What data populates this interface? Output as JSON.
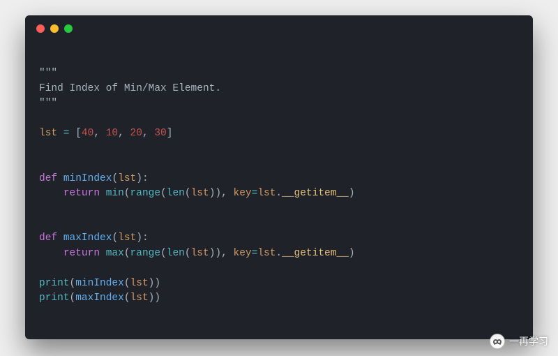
{
  "code": {
    "docstring_open": "\"\"\"",
    "docstring_text": "Find Index of Min/Max Element.",
    "docstring_close": "\"\"\"",
    "lst_name": "lst",
    "assign_op": " = ",
    "list_open": "[",
    "list_close": "]",
    "values": [
      "40",
      "10",
      "20",
      "30"
    ],
    "comma": ", ",
    "def_kw": "def",
    "fn_min": "minIndex",
    "fn_max": "maxIndex",
    "param": "lst",
    "paren_open": "(",
    "paren_close": ")",
    "colon": ":",
    "indent": "    ",
    "return_kw": "return",
    "builtin_min": "min",
    "builtin_max": "max",
    "builtin_range": "range",
    "builtin_len": "len",
    "kw_key": "key",
    "eq": "=",
    "dot": ".",
    "dunder": "__getitem__",
    "print": "print",
    "space": " "
  },
  "watermark": {
    "label": "一再学习"
  }
}
